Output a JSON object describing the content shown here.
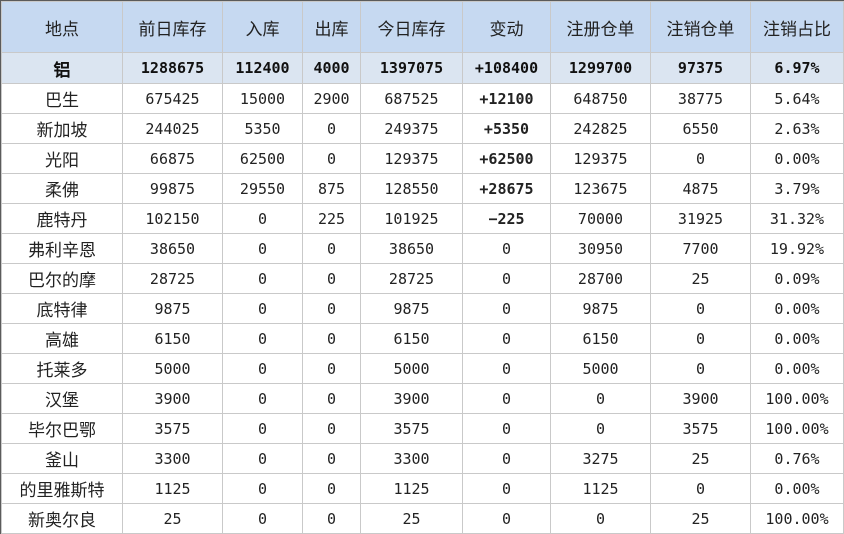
{
  "colors": {
    "header_bg": "#c6d9f1",
    "summary_bg": "#dbe5f1",
    "positive": "#e0282e",
    "negative": "#5aa02c"
  },
  "headers": [
    "地点",
    "前日库存",
    "入库",
    "出库",
    "今日库存",
    "变动",
    "注册仓单",
    "注销仓单",
    "注销占比"
  ],
  "summary": [
    "铝",
    "1288675",
    "112400",
    "4000",
    "1397075",
    "+108400",
    "1299700",
    "97375",
    "6.97%"
  ],
  "rows": [
    [
      "巴生",
      "675425",
      "15000",
      "2900",
      "687525",
      "+12100",
      "648750",
      "38775",
      "5.64%"
    ],
    [
      "新加坡",
      "244025",
      "5350",
      "0",
      "249375",
      "+5350",
      "242825",
      "6550",
      "2.63%"
    ],
    [
      "光阳",
      "66875",
      "62500",
      "0",
      "129375",
      "+62500",
      "129375",
      "0",
      "0.00%"
    ],
    [
      "柔佛",
      "99875",
      "29550",
      "875",
      "128550",
      "+28675",
      "123675",
      "4875",
      "3.79%"
    ],
    [
      "鹿特丹",
      "102150",
      "0",
      "225",
      "101925",
      "-225",
      "70000",
      "31925",
      "31.32%"
    ],
    [
      "弗利辛恩",
      "38650",
      "0",
      "0",
      "38650",
      "0",
      "30950",
      "7700",
      "19.92%"
    ],
    [
      "巴尔的摩",
      "28725",
      "0",
      "0",
      "28725",
      "0",
      "28700",
      "25",
      "0.09%"
    ],
    [
      "底特律",
      "9875",
      "0",
      "0",
      "9875",
      "0",
      "9875",
      "0",
      "0.00%"
    ],
    [
      "高雄",
      "6150",
      "0",
      "0",
      "6150",
      "0",
      "6150",
      "0",
      "0.00%"
    ],
    [
      "托莱多",
      "5000",
      "0",
      "0",
      "5000",
      "0",
      "5000",
      "0",
      "0.00%"
    ],
    [
      "汉堡",
      "3900",
      "0",
      "0",
      "3900",
      "0",
      "0",
      "3900",
      "100.00%"
    ],
    [
      "毕尔巴鄂",
      "3575",
      "0",
      "0",
      "3575",
      "0",
      "0",
      "3575",
      "100.00%"
    ],
    [
      "釜山",
      "3300",
      "0",
      "0",
      "3300",
      "0",
      "3275",
      "25",
      "0.76%"
    ],
    [
      "的里雅斯特",
      "1125",
      "0",
      "0",
      "1125",
      "0",
      "1125",
      "0",
      "0.00%"
    ],
    [
      "新奥尔良",
      "25",
      "0",
      "0",
      "25",
      "0",
      "0",
      "25",
      "100.00%"
    ]
  ]
}
